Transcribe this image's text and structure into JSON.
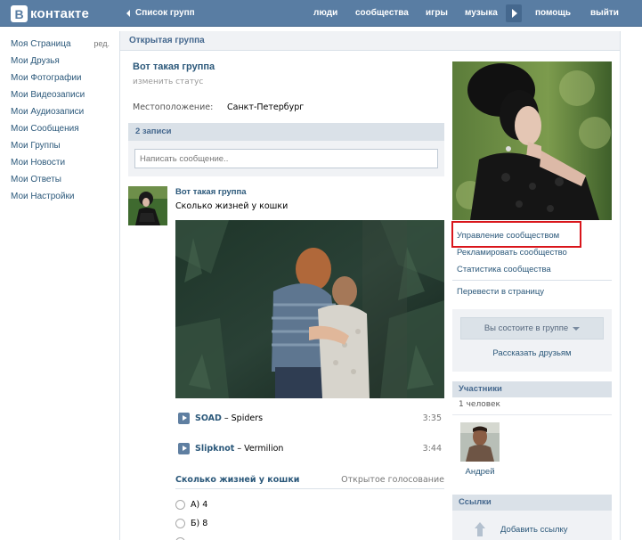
{
  "header": {
    "logo_letter": "В",
    "logo_text": "контакте",
    "back_label": "Список групп",
    "nav": [
      "люди",
      "сообщества",
      "игры",
      "музыка",
      "помощь",
      "выйти"
    ]
  },
  "leftmenu": {
    "items": [
      "Моя Страница",
      "Мои Друзья",
      "Мои Фотографии",
      "Мои Видеозаписи",
      "Мои Аудиозаписи",
      "Мои Сообщения",
      "Мои Группы",
      "Мои Новости",
      "Мои Ответы",
      "Мои Настройки"
    ],
    "edit_label": "ред."
  },
  "group": {
    "header": "Открытая группа",
    "name": "Вот такая группа",
    "status_hint": "изменить статус",
    "location_label": "Местоположение:",
    "location_value": "Санкт-Петербург"
  },
  "wall": {
    "count": "2 записи",
    "composer_placeholder": "Написать сообщение..",
    "post": {
      "author": "Вот такая группа",
      "text": "Сколько жизней у кошки",
      "tracks": [
        {
          "artist": "SOAD",
          "sep": "–",
          "title": "Spiders",
          "duration": "3:35"
        },
        {
          "artist": "Slipknot",
          "sep": "–",
          "title": "Vermilion",
          "duration": "3:44"
        }
      ],
      "poll": {
        "question": "Сколько жизней у кошки",
        "type": "Открытое голосование",
        "options": [
          "А) 4",
          "Б) 8"
        ]
      }
    }
  },
  "sidebar": {
    "manage": "Управление сообществом",
    "advertise": "Рекламировать сообщество",
    "stats": "Статистика сообщества",
    "to_page": "Перевести в страницу",
    "member_button": "Вы состоите в группе",
    "tell_friends": "Рассказать друзьям",
    "members_title": "Участники",
    "members_count": "1 человек",
    "member_name": "Андрей",
    "links_title": "Ссылки",
    "add_link": "Добавить ссылку"
  },
  "colors": {
    "header_blue": "#597da3",
    "link_blue": "#2b587a",
    "highlight_red": "#d9151b"
  }
}
